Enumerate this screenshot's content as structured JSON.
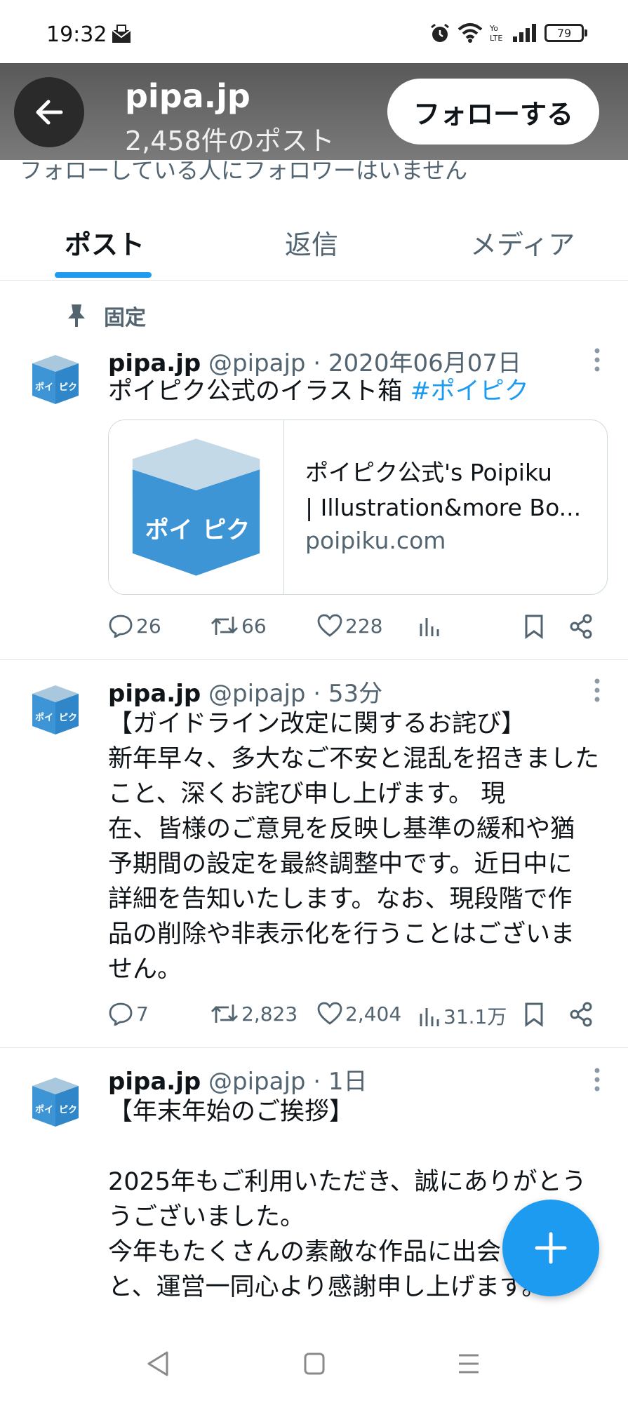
{
  "status_bar": {
    "time": "19:32",
    "battery": "79",
    "icons": [
      "mail-notification-icon",
      "alarm-icon",
      "wifi-icon",
      "volte-icon",
      "signal-icon",
      "battery-icon"
    ]
  },
  "header": {
    "name": "pipa.jp",
    "post_count": "2,458件のポスト",
    "follow_label": "フォローする"
  },
  "follower_note": "フォローしている人にフォロワーはいません",
  "tabs": [
    {
      "label": "ポスト",
      "active": true
    },
    {
      "label": "返信",
      "active": false
    },
    {
      "label": "メディア",
      "active": false
    }
  ],
  "pinned_label": "固定",
  "tweets": [
    {
      "name": "pipa.jp",
      "handle": "@pipajp",
      "time": "2020年06月07日",
      "text": "ポイピク公式のイラスト箱 ",
      "hashtag": "#ポイピク",
      "card": {
        "title_line1": "ポイピク公式's Poipiku",
        "title_line2": "| Illustration&more Bo...",
        "domain": "poipiku.com"
      },
      "replies": "26",
      "reposts": "66",
      "likes": "228",
      "views": ""
    },
    {
      "name": "pipa.jp",
      "handle": "@pipajp",
      "time": "53分",
      "text": "【ガイドライン改定に関するお詫び】\n新年早々、多大なご不安と混乱を招きました\nこと、深くお詫び申し上げます。 現\n在、皆様のご意見を反映し基準の緩和や猶\n予期間の設定を最終調整中です。近日中に\n詳細を告知いたします。なお、現段階で作\n品の削除や非表示化を行うことはございま\nせん。",
      "replies": "7",
      "reposts": "2,823",
      "likes": "2,404",
      "views": "31.1万"
    },
    {
      "name": "pipa.jp",
      "handle": "@pipajp",
      "time": "1日",
      "text": "【年末年始のご挨拶】\n\n2025年もご利用いただき、誠にありがとう\nうございました。\n今年もたくさんの素敵な作品に出会えたこ\nと、運営一同心より感謝申し上げます。"
    }
  ],
  "avatar_text": "ポイ ピク",
  "colors": {
    "accent": "#1d9bf0",
    "text": "#0f1419",
    "secondary": "#536471",
    "avatar_blue": "#3d95d6"
  }
}
